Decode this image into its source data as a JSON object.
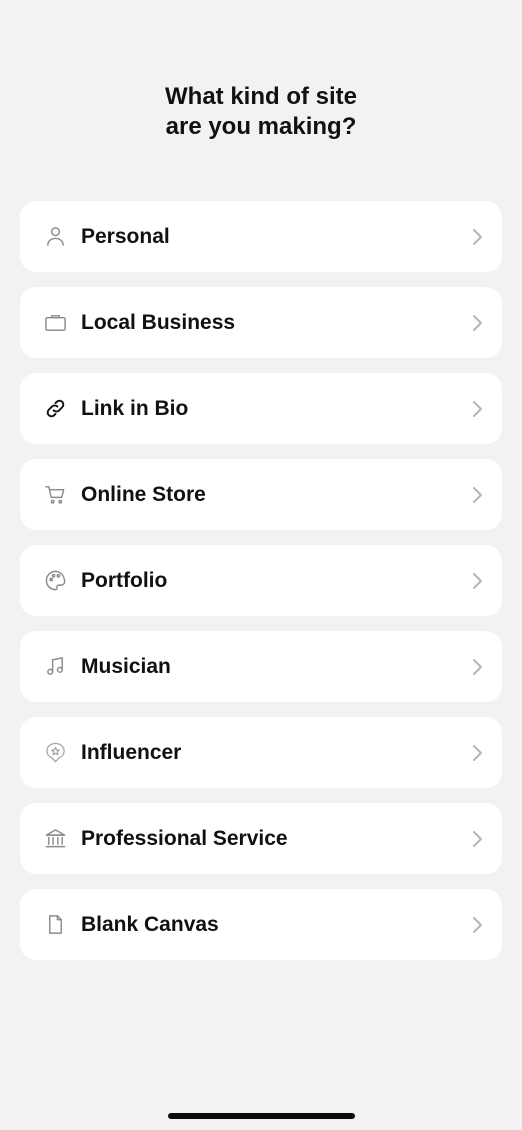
{
  "header": {
    "title_line1": "What kind of site",
    "title_line2": "are you making?"
  },
  "options": [
    {
      "label": "Personal",
      "icon": "person-icon"
    },
    {
      "label": "Local Business",
      "icon": "briefcase-icon"
    },
    {
      "label": "Link in Bio",
      "icon": "link-icon"
    },
    {
      "label": "Online Store",
      "icon": "cart-icon"
    },
    {
      "label": "Portfolio",
      "icon": "palette-icon"
    },
    {
      "label": "Musician",
      "icon": "music-note-icon"
    },
    {
      "label": "Influencer",
      "icon": "star-badge-icon"
    },
    {
      "label": "Professional Service",
      "icon": "bank-icon"
    },
    {
      "label": "Blank Canvas",
      "icon": "document-icon"
    }
  ],
  "colors": {
    "background": "#f2f2f2",
    "card": "#ffffff",
    "text": "#111111",
    "icon": "#8a8a8a",
    "chevron": "#b5b5b5"
  }
}
